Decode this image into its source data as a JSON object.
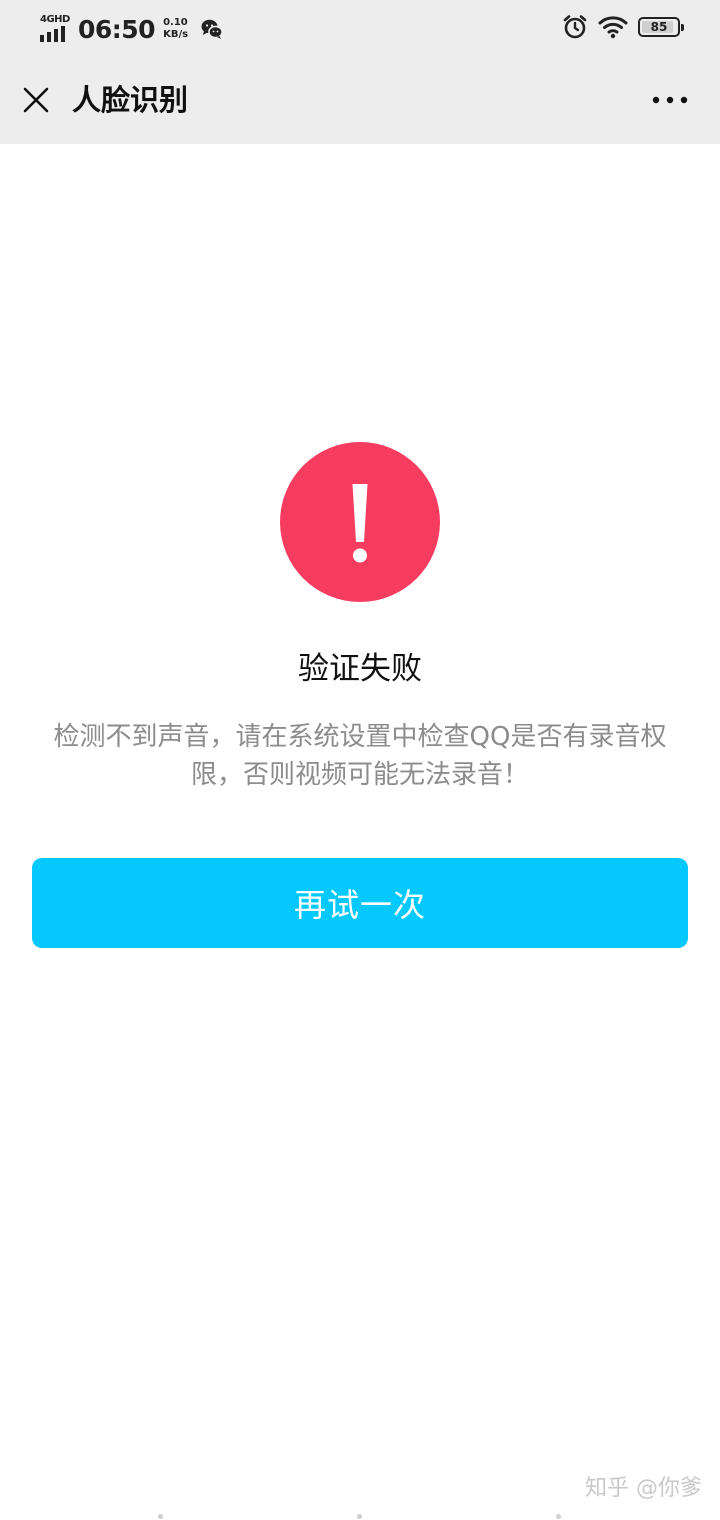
{
  "status_bar": {
    "network": "4GHD",
    "time": "06:50",
    "speed_value": "0.10",
    "speed_unit": "KB/s",
    "battery": "85",
    "icons": [
      "signal-icon",
      "wechat-icon",
      "alarm-icon",
      "wifi-icon",
      "battery-icon"
    ]
  },
  "nav": {
    "title": "人脸识别",
    "close_icon": "close-icon",
    "more_icon": "more-icon"
  },
  "result": {
    "icon": "error-icon",
    "icon_color": "#f73d5f",
    "title": "验证失败",
    "description": "检测不到声音，请在系统设置中检查QQ是否有录音权限，否则视频可能无法录音！"
  },
  "actions": {
    "retry_label": "再试一次",
    "retry_color": "#05c8fc"
  },
  "watermark": "知乎 @你爹"
}
